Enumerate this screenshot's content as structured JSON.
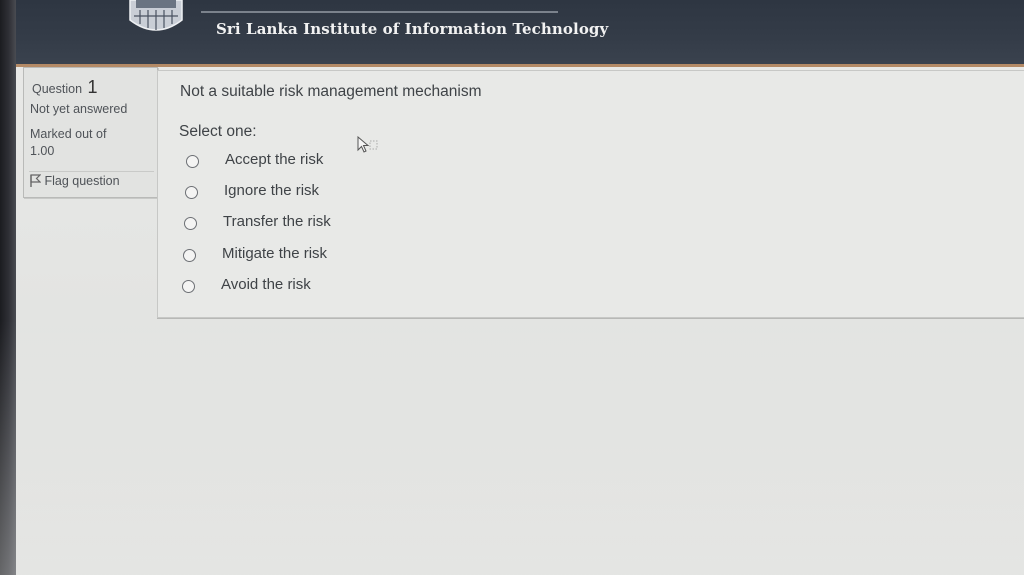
{
  "header": {
    "institution": "Sri Lanka Institute of Information Technology",
    "logo_icon": "sliit-logo-icon"
  },
  "question_info": {
    "label": "Question",
    "number": "1",
    "state": "Not yet answered",
    "grade": "Marked out of 1.00",
    "flag_label": "Flag question",
    "flag_icon": "flag-icon"
  },
  "question": {
    "text": "Not a suitable risk management mechanism",
    "prompt": "Select one:",
    "options": [
      "Accept the risk",
      "Ignore the risk",
      "Transfer the risk",
      "Mitigate the risk",
      "Avoid the risk"
    ]
  },
  "colors": {
    "header_bg": "#343c48",
    "header_accent": "#b48a66",
    "text": "#3f4347",
    "panel_bg": "#e8e9e7"
  }
}
